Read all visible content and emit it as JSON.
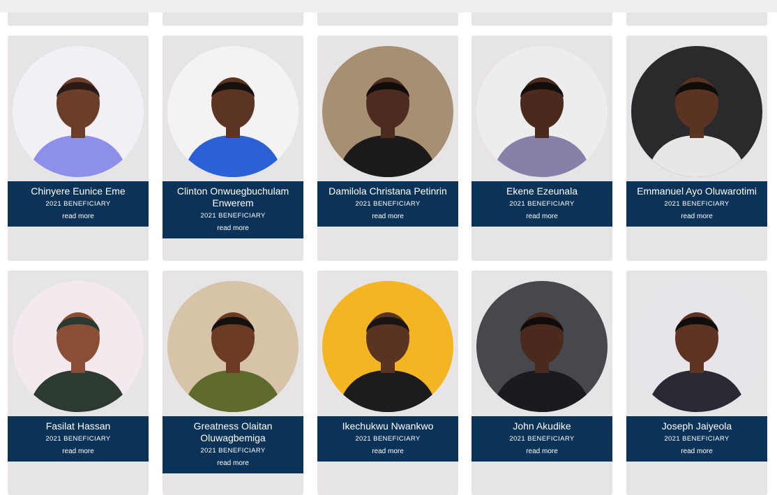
{
  "section": {
    "tag_label": "2021 BENEFICIARY",
    "read_more_label": "read more"
  },
  "beneficiaries": [
    {
      "name": "Chinyere Eunice Eme",
      "bg": "#f2f0f6",
      "shirt": "#8d8fe9",
      "skin": "#6b3e2a",
      "hair": "#2a1a16"
    },
    {
      "name": "Clinton Onwuegbuchulam Enwerem",
      "bg": "#f4f2f3",
      "shirt": "#2a62d6",
      "skin": "#5b3424",
      "hair": "#15100e"
    },
    {
      "name": "Damilola Christana Petinrin",
      "bg": "#a68f72",
      "shirt": "#1c1a1b",
      "skin": "#4c2c1f",
      "hair": "#120d0b"
    },
    {
      "name": "Ekene Ezeunala",
      "bg": "#eeedee",
      "shirt": "#8780a9",
      "skin": "#4a2a1d",
      "hair": "#120e0c"
    },
    {
      "name": "Emmanuel Ayo Oluwarotimi",
      "bg": "#2a2a2c",
      "shirt": "#e9e7e6",
      "skin": "#5a3322",
      "hair": "#100c0a"
    },
    {
      "name": "Fasilat Hassan",
      "bg": "#f3e9ee",
      "shirt": "#2d3a32",
      "skin": "#8a4e34",
      "hair": "#2b382f"
    },
    {
      "name": "Greatness Olaitan Oluwagbemiga",
      "bg": "#d7c3a8",
      "shirt": "#5e6b2d",
      "skin": "#6b3b24",
      "hair": "#15100d"
    },
    {
      "name": "Ikechukwu Nwankwo",
      "bg": "#f4b523",
      "shirt": "#1c1c1e",
      "skin": "#5a3322",
      "hair": "#1a1512"
    },
    {
      "name": "John Akudike",
      "bg": "#46484d",
      "shirt": "#1b1b1f",
      "skin": "#4a2a1c",
      "hair": "#0f0c0b"
    },
    {
      "name": "Joseph Jaiyeola",
      "bg": "#e7e4ea",
      "shirt": "#2a2833",
      "skin": "#5d3322",
      "hair": "#110d0c"
    }
  ]
}
